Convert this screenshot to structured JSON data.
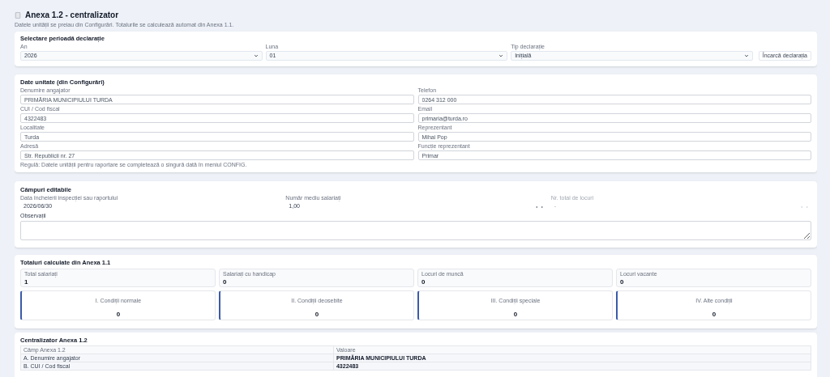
{
  "page": {
    "title": "Anexa 1.2 - centralizator",
    "subtitle": "Datele unității se preiau din Configurări. Totalurile se calculează automat din Anexa 1.1."
  },
  "period": {
    "title": "Selectare perioadă declarație",
    "fields": [
      {
        "label": "An",
        "value": "2026"
      },
      {
        "label": "Luna",
        "value": "01"
      },
      {
        "label": "Tip declarație",
        "value": "Inițială"
      }
    ],
    "button": "Încarcă declarația"
  },
  "unit": {
    "title": "Date unitate (din Configurări)",
    "fields": [
      {
        "label": "Denumire angajator",
        "value": "PRIMĂRIA MUNICIPIULUI TURDA"
      },
      {
        "label": "Telefon",
        "value": "0264 312 000"
      },
      {
        "label": "CUI / Cod fiscal",
        "value": "4322483"
      },
      {
        "label": "Email",
        "value": "primaria@turda.ro"
      },
      {
        "label": "Localitate",
        "value": "Turda"
      },
      {
        "label": "Reprezentant",
        "value": "Mihai Pop"
      },
      {
        "label": "Adresă",
        "value": "Str. Republicii nr. 27"
      },
      {
        "label": "Funcție reprezentant",
        "value": "Primar"
      }
    ],
    "note": "Regulă: Datele unității pentru raportare se completează o singură dată în meniul CONFIG."
  },
  "editable": {
    "title": "Câmpuri editabile",
    "fields": [
      {
        "label": "Data încheierii inspecției sau raportului",
        "value": "2026/06/30",
        "disabled": false,
        "kind": "date"
      },
      {
        "label": "Număr mediu salariați",
        "value": "1,00",
        "disabled": false,
        "kind": "number"
      },
      {
        "label": "Nr. total de locuri",
        "value": "-",
        "disabled": true,
        "kind": "number"
      }
    ],
    "notes_label": "Observații"
  },
  "totals": {
    "title": "Totaluri calculate din Anexa 1.1",
    "stats": [
      {
        "label": "Total salariați",
        "value": "1"
      },
      {
        "label": "Salariați cu handicap",
        "value": "0"
      },
      {
        "label": "Locuri de muncă",
        "value": "0"
      },
      {
        "label": "Locuri vacante",
        "value": "0"
      }
    ],
    "conditions": [
      {
        "label": "I. Condiții normale",
        "value": "0"
      },
      {
        "label": "II. Condiții deosebite",
        "value": "0"
      },
      {
        "label": "III. Condiții speciale",
        "value": "0"
      },
      {
        "label": "IV. Alte condiții",
        "value": "0"
      }
    ]
  },
  "summary": {
    "title": "Centralizator Anexa 1.2",
    "columns": [
      "Câmp Anexa 1.2",
      "Valoare"
    ],
    "rows": [
      [
        "A. Denumire angajator",
        "PRIMĂRIA MUNICIPIULUI TURDA"
      ],
      [
        "B. CUI / Cod fiscal",
        "4322483"
      ]
    ]
  }
}
